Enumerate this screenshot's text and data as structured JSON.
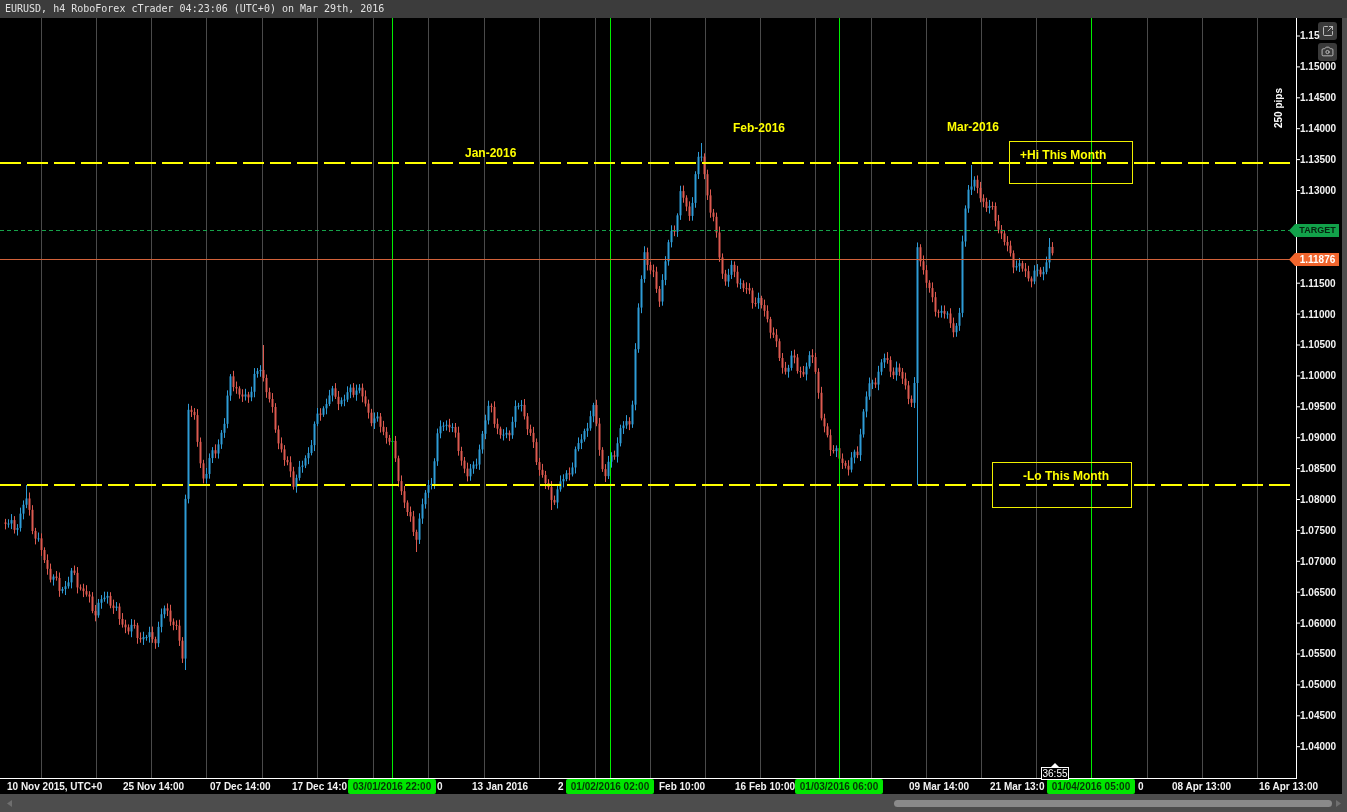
{
  "window": {
    "title": "EURUSD, h4 RoboForex cTrader 04:23:06 (UTC+0) on Mar 29th, 2016"
  },
  "chart": {
    "range_label": "250 pips",
    "price_axis": {
      "labels_above_markers": [
        "1.15",
        "1.15000",
        "1.14500",
        "1.14000",
        "1.13500",
        "1.13000"
      ],
      "labels_below_markers": [
        "1.11500",
        "1.11000",
        "1.10500",
        "1.10000",
        "1.09500",
        "1.09000",
        "1.08500",
        "1.08000",
        "1.07500",
        "1.07000",
        "1.06500",
        "1.06000",
        "1.05500",
        "1.05000",
        "1.04500",
        "1.04000"
      ]
    },
    "month_labels": [
      "Jan-2016",
      "Feb-2016",
      "Mar-2016"
    ],
    "levels": [
      {
        "label": "+Hi This Month"
      },
      {
        "label": "-Lo This Month"
      }
    ],
    "markers": [
      {
        "kind": "target",
        "label": "TARGET"
      },
      {
        "kind": "price",
        "label": "1.11876"
      }
    ],
    "month_separators": [
      {
        "label": "03/01/2016 22:00"
      },
      {
        "label": "01/02/2016 02:00"
      },
      {
        "label": "01/03/2016 06:00"
      },
      {
        "label": "01/04/2016 05:00"
      }
    ],
    "time_axis": {
      "labels": [
        "10 Nov 2015, UTC+0",
        "25 Nov 14:00",
        "07 Dec 14:00",
        "17 Dec 14:0",
        "0",
        "13 Jan 2016",
        "2",
        "Feb 10:00",
        "16 Feb 10:00",
        "09 Mar 14:00",
        "21 Mar 13:0",
        "0",
        "08 Apr 13:00",
        "16 Apr 13:00"
      ]
    },
    "countdown": "36:55"
  }
}
